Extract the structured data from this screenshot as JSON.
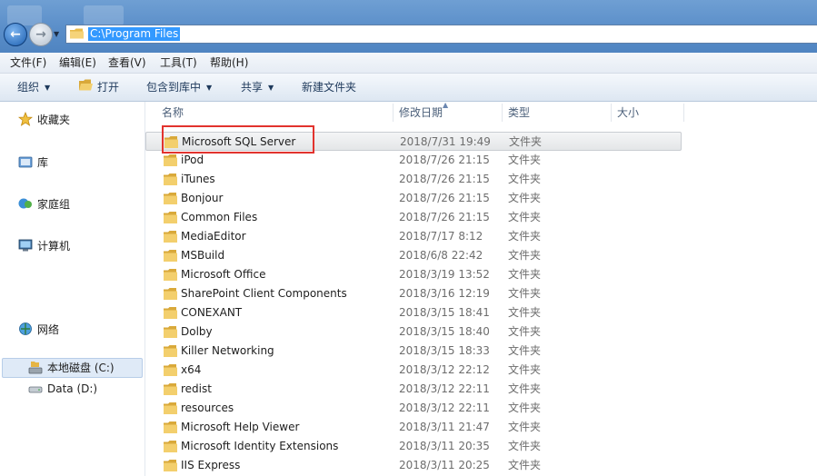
{
  "address": {
    "path": "C:\\Program Files"
  },
  "menu": {
    "items": [
      "文件(F)",
      "编辑(E)",
      "查看(V)",
      "工具(T)",
      "帮助(H)"
    ]
  },
  "toolbar": {
    "organize": "组织",
    "open": "打开",
    "include_library": "包含到库中",
    "share": "共享",
    "new_folder": "新建文件夹"
  },
  "nav": {
    "favorites": "收藏夹",
    "libraries": "库",
    "homegroup": "家庭组",
    "computer": "计算机",
    "local_disk": "本地磁盘 (C:)",
    "data_disk": "Data (D:)",
    "network": "网络"
  },
  "columns": {
    "name": "名称",
    "date": "修改日期",
    "type": "类型",
    "size": "大小"
  },
  "files": [
    {
      "name": "Microsoft SQL Server",
      "date": "2018/7/31 19:49",
      "type": "文件夹"
    },
    {
      "name": "iPod",
      "date": "2018/7/26 21:15",
      "type": "文件夹"
    },
    {
      "name": "iTunes",
      "date": "2018/7/26 21:15",
      "type": "文件夹"
    },
    {
      "name": "Bonjour",
      "date": "2018/7/26 21:15",
      "type": "文件夹"
    },
    {
      "name": "Common Files",
      "date": "2018/7/26 21:15",
      "type": "文件夹"
    },
    {
      "name": "MediaEditor",
      "date": "2018/7/17 8:12",
      "type": "文件夹"
    },
    {
      "name": "MSBuild",
      "date": "2018/6/8 22:42",
      "type": "文件夹"
    },
    {
      "name": "Microsoft Office",
      "date": "2018/3/19 13:52",
      "type": "文件夹"
    },
    {
      "name": "SharePoint Client Components",
      "date": "2018/3/16 12:19",
      "type": "文件夹"
    },
    {
      "name": "CONEXANT",
      "date": "2018/3/15 18:41",
      "type": "文件夹"
    },
    {
      "name": "Dolby",
      "date": "2018/3/15 18:40",
      "type": "文件夹"
    },
    {
      "name": "Killer Networking",
      "date": "2018/3/15 18:33",
      "type": "文件夹"
    },
    {
      "name": "x64",
      "date": "2018/3/12 22:12",
      "type": "文件夹"
    },
    {
      "name": "redist",
      "date": "2018/3/12 22:11",
      "type": "文件夹"
    },
    {
      "name": "resources",
      "date": "2018/3/12 22:11",
      "type": "文件夹"
    },
    {
      "name": "Microsoft Help Viewer",
      "date": "2018/3/11 21:47",
      "type": "文件夹"
    },
    {
      "name": "Microsoft Identity Extensions",
      "date": "2018/3/11 20:35",
      "type": "文件夹"
    },
    {
      "name": "IIS Express",
      "date": "2018/3/11 20:25",
      "type": "文件夹"
    }
  ],
  "colors": {
    "title_bar": "#5a8ec9",
    "selection": "#3399ff",
    "highlight_annotation": "#e2332e"
  }
}
